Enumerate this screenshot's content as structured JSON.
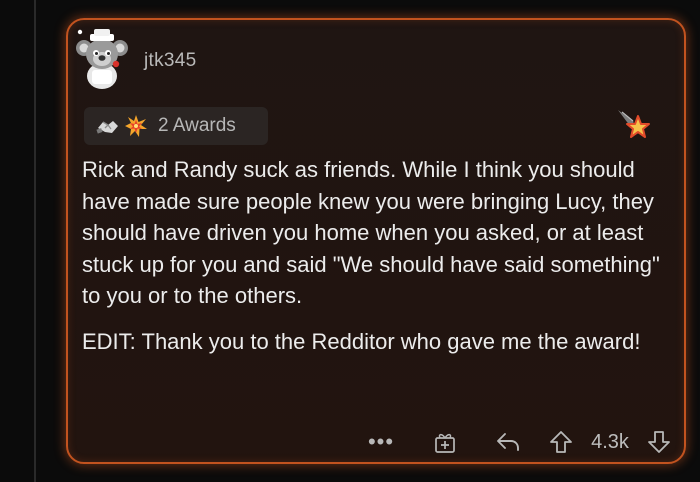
{
  "comment": {
    "username": "jtk345",
    "awards": {
      "label": "2 Awards",
      "icons": [
        "handshake-award-icon",
        "explosion-award-icon"
      ]
    },
    "flair_icon": "shooting-star-icon",
    "paragraphs": [
      "Rick and Randy suck as friends. While I think you should have made sure people knew you were bringing Lucy, they should have driven you home when you asked, or at least stuck up for you and said \"We should have said something\" to you or to the others.",
      "EDIT: Thank you to the Redditor who gave me the award!"
    ],
    "actions": {
      "more": "•••",
      "score": "4.3k"
    }
  },
  "colors": {
    "background": "#0b0b0b",
    "card_background": "#21150f",
    "highlight_border": "#c2531f",
    "text_primary": "#ececec",
    "text_secondary": "#b9b9b9"
  }
}
